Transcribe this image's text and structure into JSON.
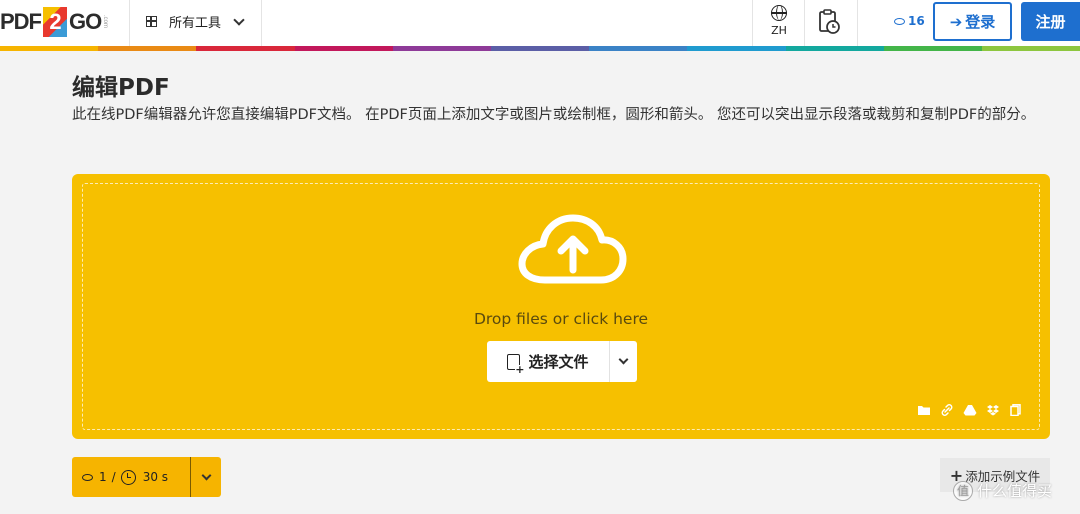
{
  "header": {
    "logo": {
      "part1": "PDF",
      "part2": "2",
      "part3": "GO",
      "suffix": ".com"
    },
    "tools_label": "所有工具",
    "lang_label": "ZH",
    "credits": "16",
    "login_label": "登录",
    "register_label": "注册"
  },
  "rainbow_colors": [
    "#f6b400",
    "#e98a15",
    "#d9273a",
    "#c2185b",
    "#8e3a98",
    "#5b5ea6",
    "#3a82c6",
    "#1f9bcf",
    "#13a89e",
    "#43b549",
    "#8dc63f"
  ],
  "page": {
    "title": "编辑PDF",
    "description": "此在线PDF编辑器允许您直接编辑PDF文档。 在PDF页面上添加文字或图片或绘制框，圆形和箭头。 您还可以突出显示段落或裁剪和复制PDF的部分。"
  },
  "upload": {
    "drop_text": "Drop files or click here",
    "choose_label": "选择文件",
    "sources": [
      "folder-icon",
      "link-icon",
      "google-drive-icon",
      "dropbox-icon",
      "copy-icon"
    ]
  },
  "limits": {
    "credits": "1",
    "separator": "/",
    "time": "30 s"
  },
  "sample": {
    "label": "添加示例文件"
  },
  "watermark": {
    "text": "什么值得买",
    "logo_char": "值"
  },
  "colors": {
    "accent": "#f6c000",
    "brand_blue": "#1e6fcf",
    "credit_box": "#f6b400"
  }
}
